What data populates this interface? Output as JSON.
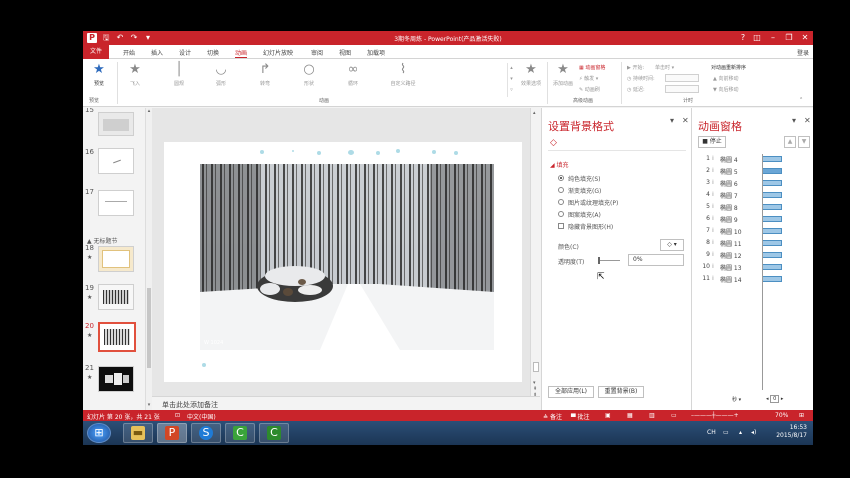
{
  "window": {
    "title": "3期冬周炼 - PowerPoint(产品激活失败)",
    "help": "?",
    "ribbon_display": "◫",
    "minimize": "–",
    "restore": "❐",
    "close": "✕"
  },
  "qat": {
    "save": "🖫",
    "undo": "↶",
    "redo": "↷",
    "customize": "▾"
  },
  "tabs": [
    "文件",
    "开始",
    "插入",
    "设计",
    "切换",
    "动画",
    "幻灯片放映",
    "审阅",
    "视图",
    "加载项"
  ],
  "login": "登录",
  "ribbon": {
    "preview": "预览",
    "preview_group": "预览",
    "effects": [
      "飞入",
      "圆规",
      "弧形",
      "转弯",
      "形状",
      "循环",
      "自定义路径"
    ],
    "effect_options": "效果选项",
    "animation_group": "动画",
    "add_animation": "添加动画",
    "animation_pane": "动画窗格",
    "trigger": "触发",
    "animation_painter": "动画刷",
    "advanced_group": "高级动画",
    "start_label": "开始:",
    "start_value": "单击时",
    "duration_label": "持续时间:",
    "delay_label": "延迟:",
    "reorder_title": "对动画重新排序",
    "move_earlier": "向前移动",
    "move_later": "向后移动",
    "timing_group": "计时"
  },
  "thumbnails": {
    "slides": [
      {
        "num": "15"
      },
      {
        "num": "16"
      },
      {
        "num": "17"
      },
      {
        "num": "18",
        "star": "★"
      },
      {
        "num": "19",
        "star": "★"
      },
      {
        "num": "20",
        "star": "★"
      },
      {
        "num": "21",
        "star": "★"
      }
    ],
    "section": "▲ 无标题节"
  },
  "slide": {
    "caption": "W 1024"
  },
  "notes_placeholder": "单击此处添加备注",
  "format_pane": {
    "title": "设置背景格式",
    "section": "◢ 填充",
    "options": [
      "纯色填充(S)",
      "渐变填充(G)",
      "图片或纹理填充(P)",
      "图案填充(A)"
    ],
    "hide_bg": "隐藏背景图形(H)",
    "color_label": "颜色(C)",
    "transparency_label": "透明度(T)",
    "transparency_value": "0%",
    "apply_all": "全部应用(L)",
    "reset_bg": "重置背景(B)"
  },
  "animation_pane": {
    "title": "动画窗格",
    "stop": "停止",
    "items": [
      {
        "num": "1",
        "name": "椭圆 4"
      },
      {
        "num": "2",
        "name": "椭圆 5"
      },
      {
        "num": "3",
        "name": "椭圆 6"
      },
      {
        "num": "4",
        "name": "椭圆 7"
      },
      {
        "num": "5",
        "name": "椭圆 8"
      },
      {
        "num": "6",
        "name": "椭圆 9"
      },
      {
        "num": "7",
        "name": "椭圆 10"
      },
      {
        "num": "8",
        "name": "椭圆 11"
      },
      {
        "num": "9",
        "name": "椭圆 12"
      },
      {
        "num": "10",
        "name": "椭圆 13"
      },
      {
        "num": "11",
        "name": "椭圆 14"
      }
    ],
    "seconds": "秒 ▾",
    "timeline_value": "0"
  },
  "status": {
    "slide_info": "幻灯片 第 20 张，共 21 张",
    "language": "中文(中国)",
    "notes": "备注",
    "comments": "批注",
    "zoom": "70%"
  },
  "taskbar": {
    "ime": "CH",
    "time": "16:53",
    "date": "2015/8/17"
  },
  "colors": {
    "accent": "#c9242b",
    "taskbar": "#1b3554",
    "timeline_bar": "#9ec7e6"
  }
}
